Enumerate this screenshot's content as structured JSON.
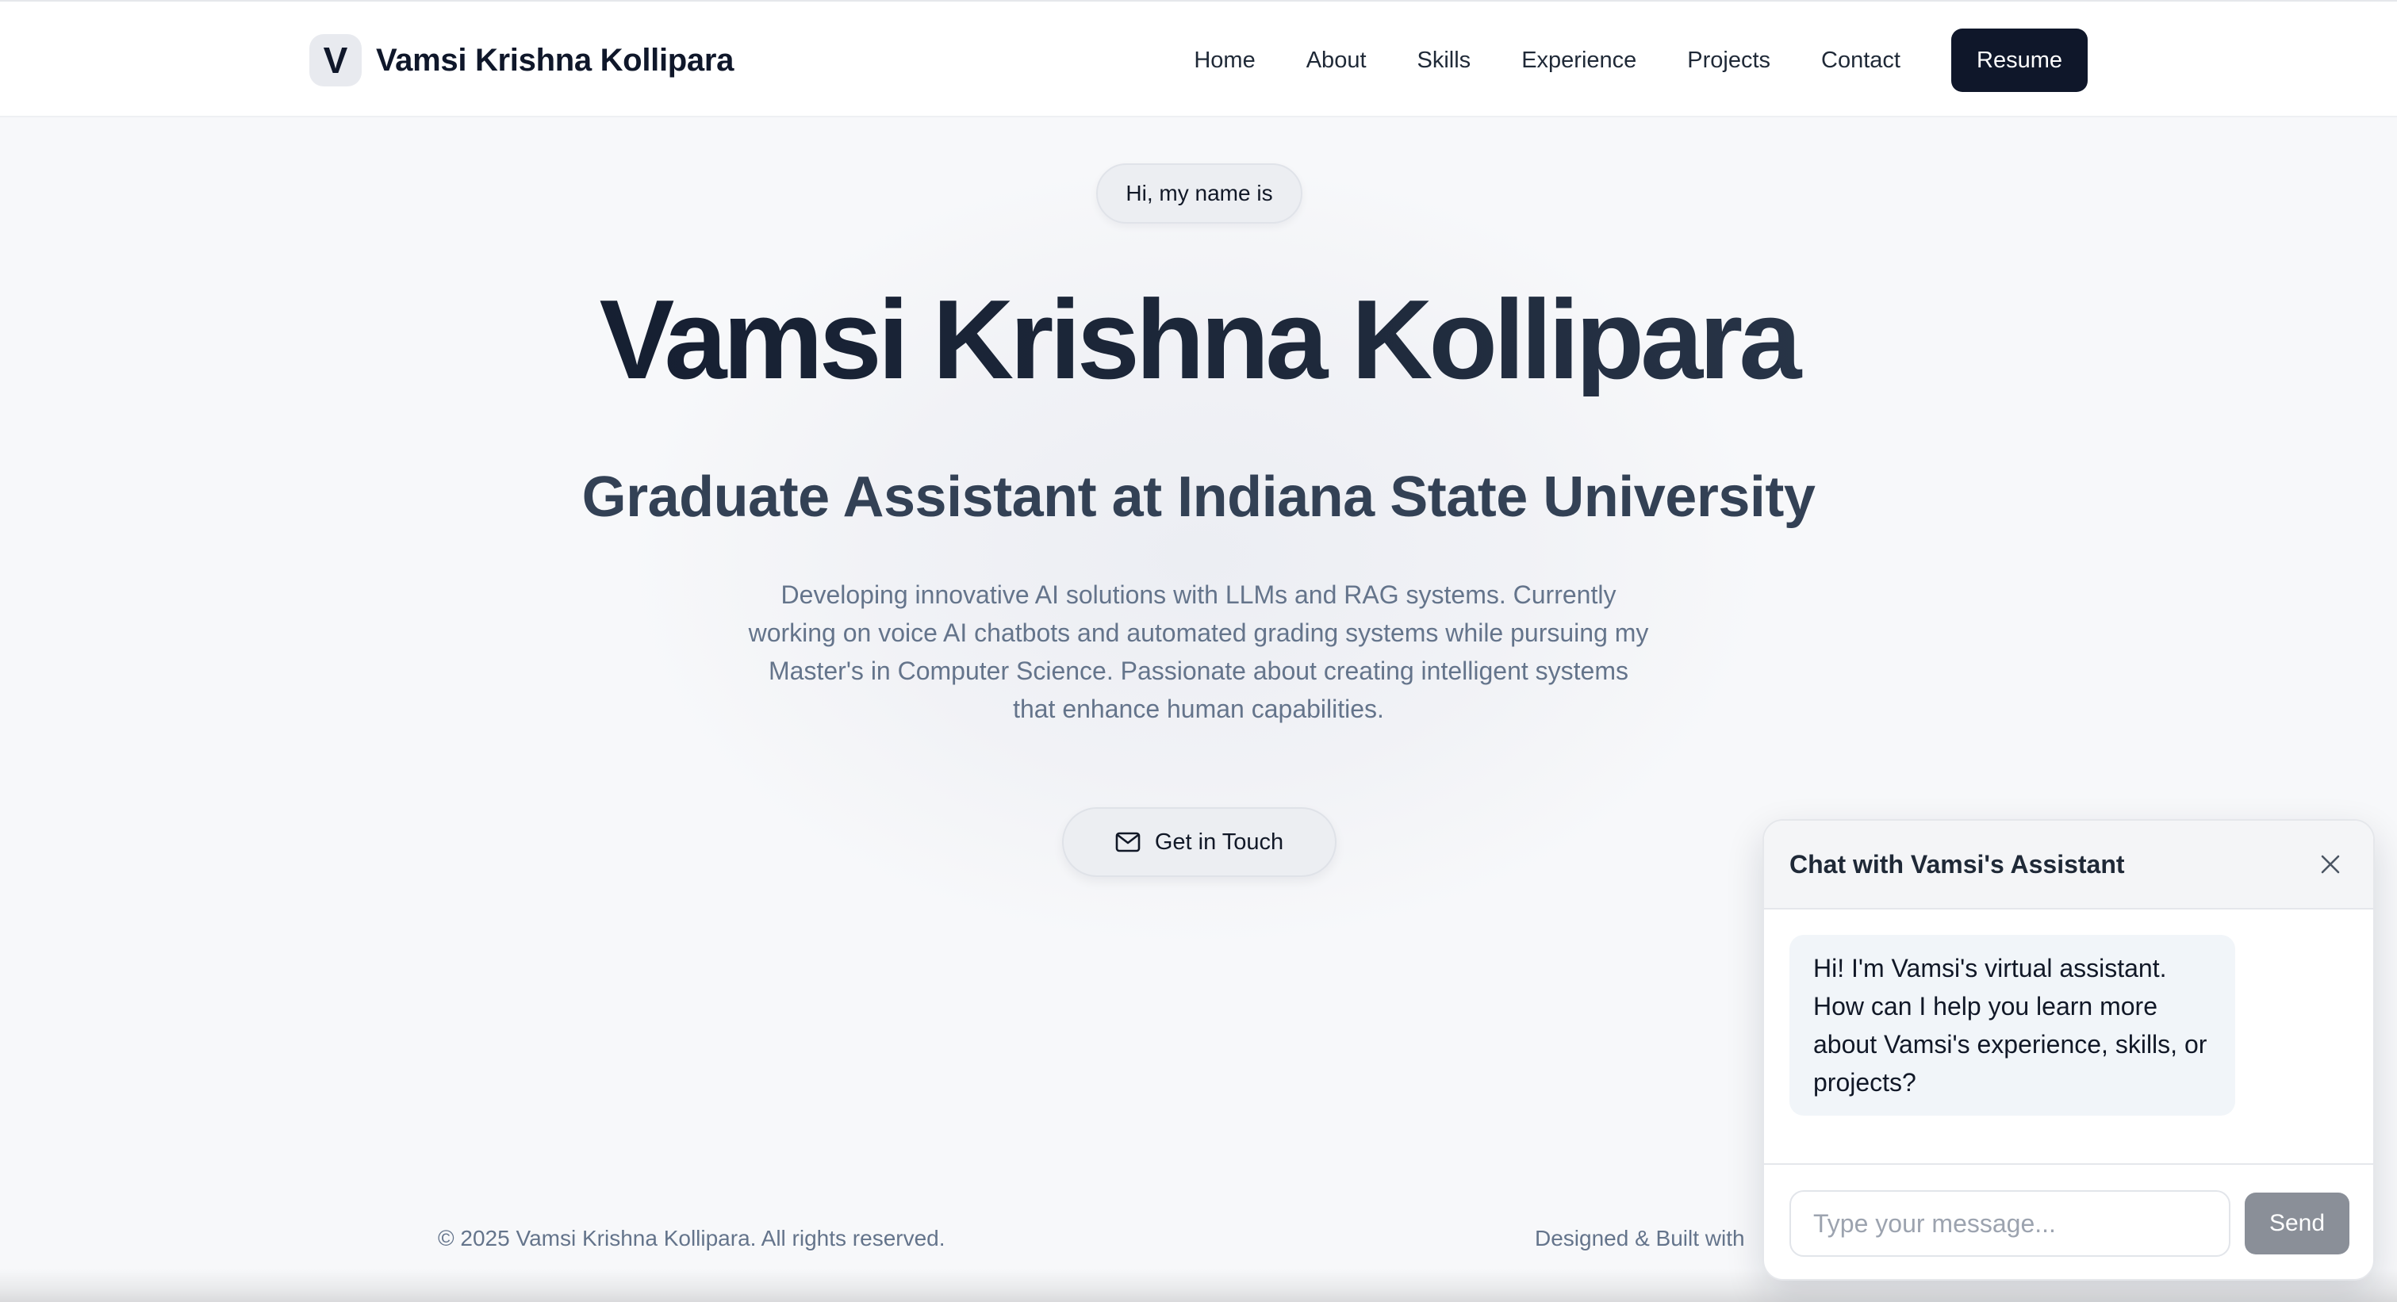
{
  "header": {
    "logo_letter": "V",
    "brand_name": "Vamsi Krishna Kollipara",
    "nav": [
      {
        "label": "Home"
      },
      {
        "label": "About"
      },
      {
        "label": "Skills"
      },
      {
        "label": "Experience"
      },
      {
        "label": "Projects"
      },
      {
        "label": "Contact"
      }
    ],
    "resume_label": "Resume"
  },
  "hero": {
    "greeting": "Hi, my name is",
    "name": "Vamsi Krishna Kollipara",
    "role": "Graduate Assistant at Indiana State University",
    "description": "Developing innovative AI solutions with LLMs and RAG systems. Currently working on voice AI chatbots and automated grading systems while pursuing my Master's in Computer Science. Passionate about creating intelligent systems that enhance human capabilities.",
    "cta_label": "Get in Touch",
    "cta_icon": "mail-icon"
  },
  "footer": {
    "copyright": "© 2025 Vamsi Krishna Kollipara. All rights reserved.",
    "credit": "Designed & Built with"
  },
  "chat": {
    "title": "Chat with Vamsi's Assistant",
    "close_icon": "close-icon",
    "assistant_message": "Hi! I'm Vamsi's virtual assistant. How can I help you learn more about Vamsi's experience, skills, or projects?",
    "input_placeholder": "Type your message...",
    "send_label": "Send"
  },
  "colors": {
    "primary_dark": "#0f172a",
    "muted_text": "#64748b",
    "send_button": "#8a8f98",
    "bubble_bg": "#f1f5f9"
  }
}
